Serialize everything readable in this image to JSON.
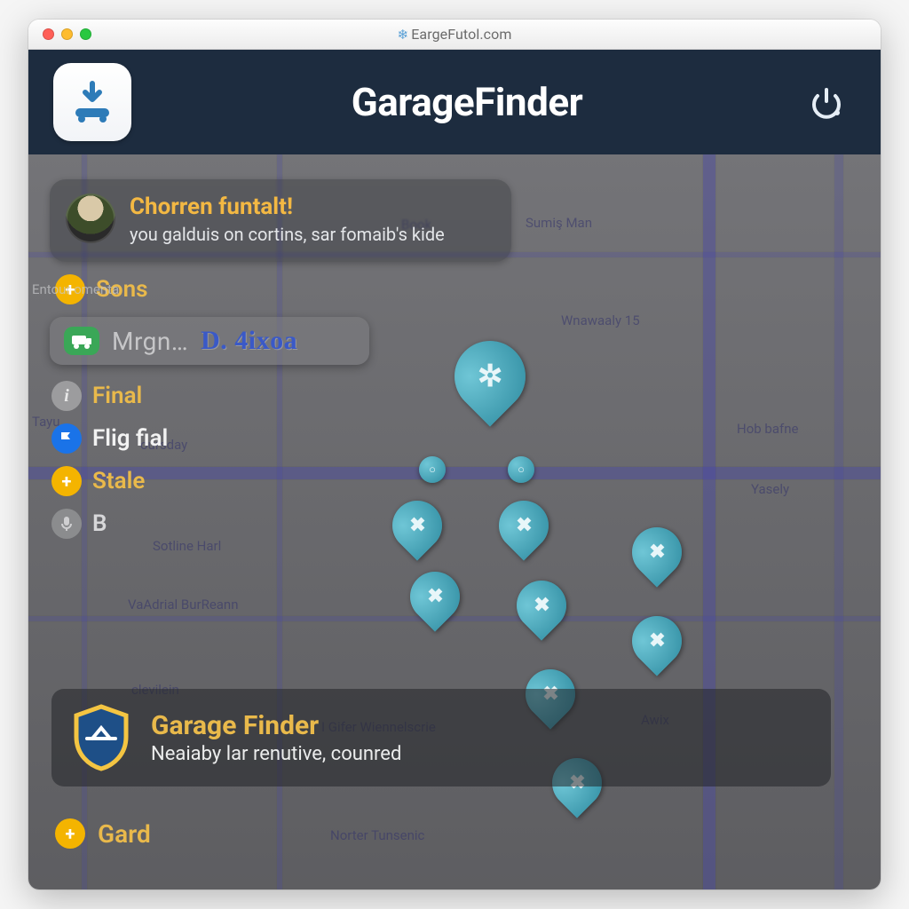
{
  "window": {
    "url_text": "EargeFutol.com"
  },
  "header": {
    "title": "GarageFinder"
  },
  "profile": {
    "title": "Chorren funtalt!",
    "subtitle": "you galduis on cortins, sar fomaib's kide"
  },
  "side_text": "Entour\nomenta",
  "first_chip": {
    "label": "Sons"
  },
  "search": {
    "placeholder": "Mrgn…",
    "value": "D. 4ixoa"
  },
  "list": [
    {
      "icon": "info",
      "label": "Final",
      "color": "gold"
    },
    {
      "icon": "blue",
      "label": "Flig fial",
      "color": "white"
    },
    {
      "icon": "plus",
      "label": "Stale",
      "color": "gold"
    },
    {
      "icon": "gray",
      "label": "B",
      "color": "muted"
    }
  ],
  "banner": {
    "title": "Garage Finder",
    "subtitle": "Neaiaby lar renutive, counred"
  },
  "bottom_chip": {
    "label": "Gard"
  },
  "colors": {
    "header_bg": "#1d2c3f",
    "gold": "#e9b94b",
    "blue": "#1a73e8",
    "teal": "#3aa3b5"
  },
  "map": {
    "labels": [
      "Book",
      "Sumiş Man",
      "Wnawaaly 15",
      "Hob bafne",
      "Yasely",
      "Tayu",
      "oursday",
      "Sotline Harl",
      "VaAdrial BurReann",
      "clevilein",
      "I Gifer Wiennelscrie",
      "Norter Tunsenic",
      "Awix"
    ]
  }
}
